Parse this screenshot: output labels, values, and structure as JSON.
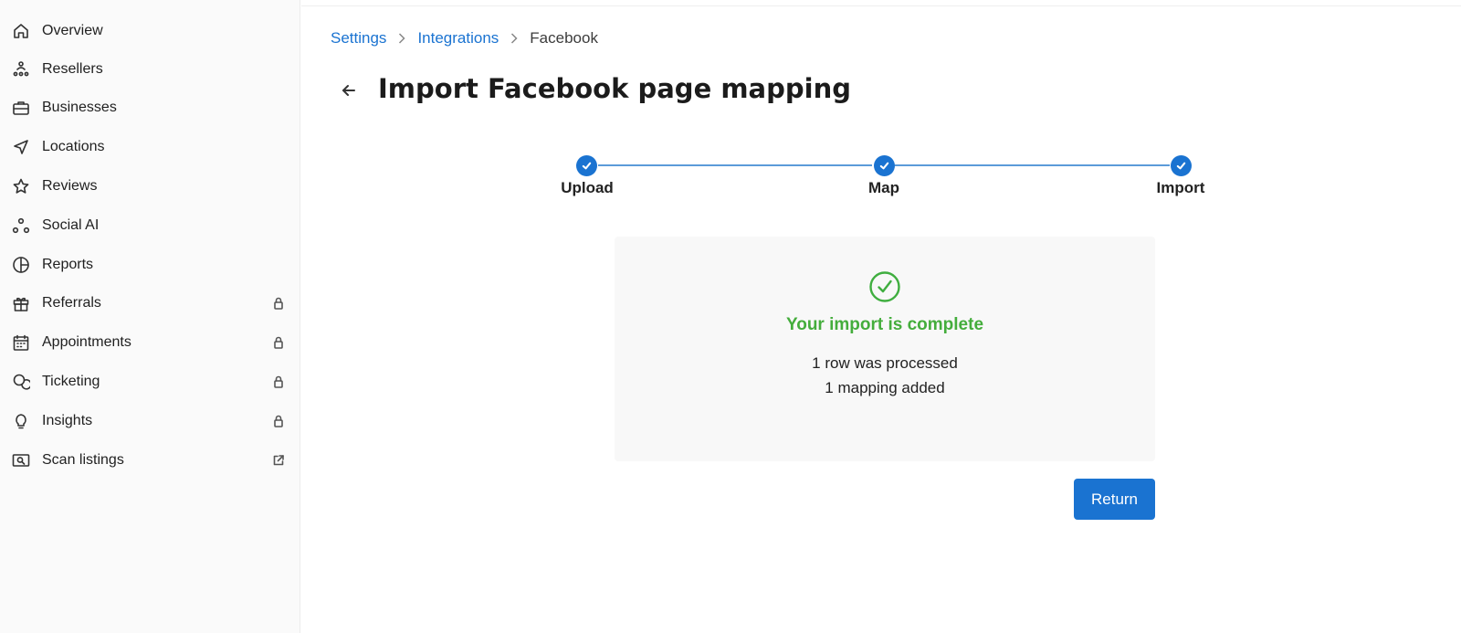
{
  "sidebar": {
    "items": [
      {
        "label": "Overview",
        "icon": "home-icon"
      },
      {
        "label": "Resellers",
        "icon": "resellers-icon"
      },
      {
        "label": "Businesses",
        "icon": "briefcase-icon"
      },
      {
        "label": "Locations",
        "icon": "location-arrow-icon"
      },
      {
        "label": "Reviews",
        "icon": "star-icon"
      },
      {
        "label": "Social AI",
        "icon": "social-nodes-icon"
      },
      {
        "label": "Reports",
        "icon": "pie-chart-icon"
      },
      {
        "label": "Referrals",
        "icon": "gift-icon",
        "trailing": "lock-icon"
      },
      {
        "label": "Appointments",
        "icon": "calendar-icon",
        "trailing": "lock-icon"
      },
      {
        "label": "Ticketing",
        "icon": "chat-bubbles-icon",
        "trailing": "lock-icon"
      },
      {
        "label": "Insights",
        "icon": "lightbulb-icon",
        "trailing": "lock-icon"
      },
      {
        "label": "Scan listings",
        "icon": "scan-icon",
        "trailing": "external-link-icon"
      }
    ]
  },
  "breadcrumb": {
    "items": [
      "Settings",
      "Integrations"
    ],
    "current": "Facebook"
  },
  "header": {
    "title": "Import Facebook page mapping"
  },
  "stepper": {
    "steps": [
      {
        "label": "Upload",
        "status": "complete"
      },
      {
        "label": "Map",
        "status": "complete"
      },
      {
        "label": "Import",
        "status": "complete"
      }
    ]
  },
  "result": {
    "title": "Your import is complete",
    "lines": [
      "1 row was processed",
      "1 mapping added"
    ]
  },
  "actions": {
    "return_label": "Return"
  },
  "colors": {
    "accent": "#1a73d1",
    "success": "#44ad3c"
  }
}
